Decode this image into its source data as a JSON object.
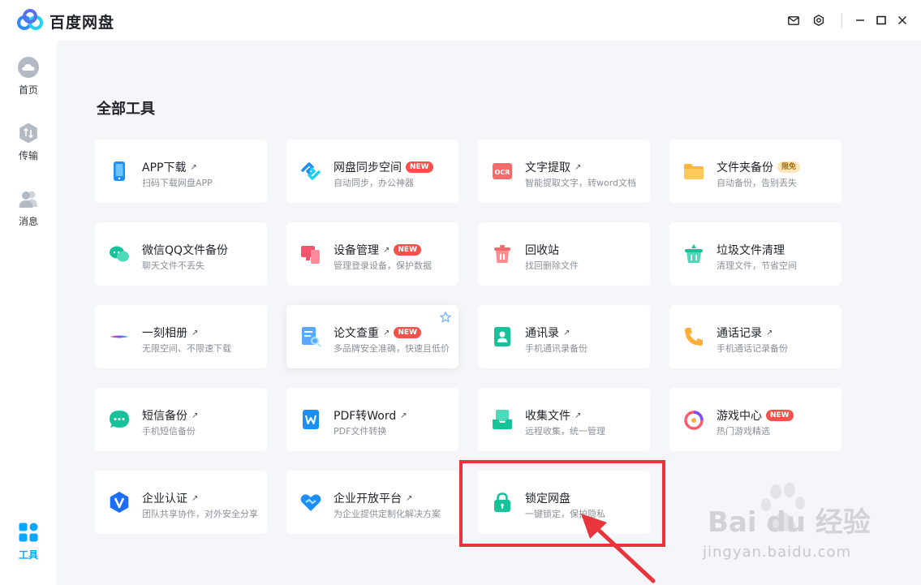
{
  "app": {
    "title": "百度网盘"
  },
  "sidebar": {
    "items": [
      {
        "label": "首页",
        "icon": "cloud-icon"
      },
      {
        "label": "传输",
        "icon": "transfer-icon"
      },
      {
        "label": "消息",
        "icon": "users-icon"
      },
      {
        "label": "工具",
        "icon": "apps-icon",
        "active": true
      }
    ]
  },
  "main": {
    "section_title": "全部工具",
    "tools": [
      {
        "name": "APP下载",
        "sub": "扫码下载网盘APP",
        "arrow": "↗",
        "badge": ""
      },
      {
        "name": "网盘同步空间",
        "sub": "自动同步，办公神器",
        "arrow": "",
        "badge": "NEW"
      },
      {
        "name": "文字提取",
        "sub": "智能提取文字，转word文档",
        "arrow": "↗",
        "badge": ""
      },
      {
        "name": "文件夹备份",
        "sub": "自动备份，告别丢失",
        "arrow": "",
        "badge": "限免"
      },
      {
        "name": "微信QQ文件备份",
        "sub": "聊天文件不丢失",
        "arrow": "",
        "badge": ""
      },
      {
        "name": "设备管理",
        "sub": "管理登录设备，保护数据",
        "arrow": "↗",
        "badge": "NEW"
      },
      {
        "name": "回收站",
        "sub": "找回删除文件",
        "arrow": "",
        "badge": ""
      },
      {
        "name": "垃圾文件清理",
        "sub": "清理文件，节省空间",
        "arrow": "",
        "badge": ""
      },
      {
        "name": "一刻相册",
        "sub": "无限空间、不限速下载",
        "arrow": "↗",
        "badge": ""
      },
      {
        "name": "论文查重",
        "sub": "多品牌安全准确，快速且低价",
        "arrow": "↗",
        "badge": "NEW"
      },
      {
        "name": "通讯录",
        "sub": "手机通讯录备份",
        "arrow": "↗",
        "badge": ""
      },
      {
        "name": "通话记录",
        "sub": "手机通话记录备份",
        "arrow": "↗",
        "badge": ""
      },
      {
        "name": "短信备份",
        "sub": "手机短信备份",
        "arrow": "↗",
        "badge": ""
      },
      {
        "name": "PDF转Word",
        "sub": "PDF文件转换",
        "arrow": "↗",
        "badge": ""
      },
      {
        "name": "收集文件",
        "sub": "远程收集，统一管理",
        "arrow": "↗",
        "badge": ""
      },
      {
        "name": "游戏中心",
        "sub": "热门游戏精选",
        "arrow": "",
        "badge": "NEW"
      },
      {
        "name": "企业认证",
        "sub": "团队共享协作，对外安全分享",
        "arrow": "↗",
        "badge": ""
      },
      {
        "name": "企业开放平台",
        "sub": "为企业提供定制化解决方案",
        "arrow": "↗",
        "badge": ""
      },
      {
        "name": "锁定网盘",
        "sub": "一键锁定，保护隐私",
        "arrow": "",
        "badge": ""
      }
    ]
  },
  "watermark": {
    "title": "Bai du 经验",
    "url": "jingyan.baidu.com"
  },
  "colors": {
    "accent": "#06a7ff",
    "highlight": "#e8353b",
    "badge_new": "#f2524a",
    "badge_free": "#fce6b8"
  }
}
